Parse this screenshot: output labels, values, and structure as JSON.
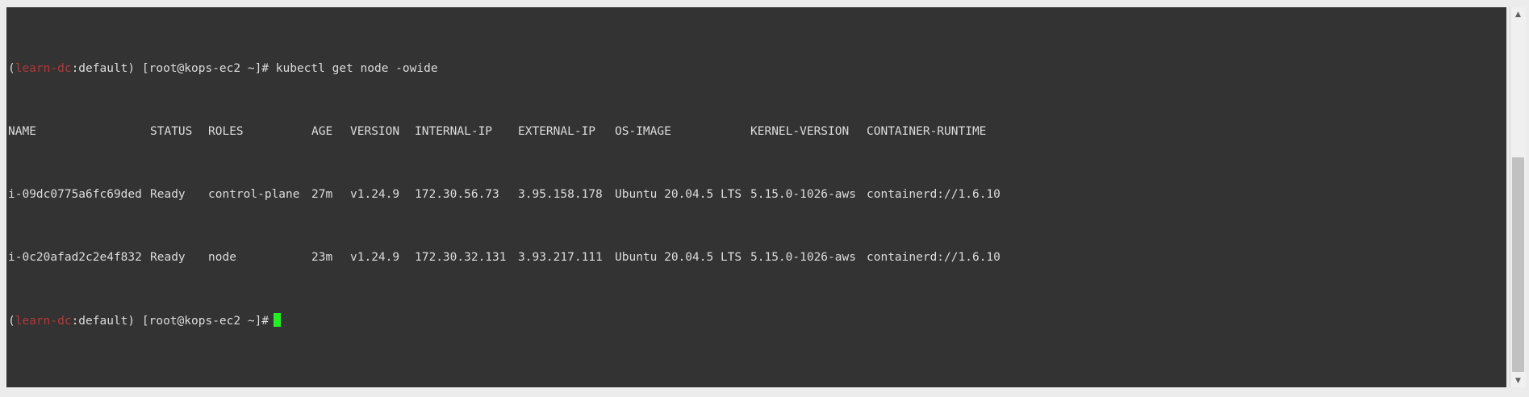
{
  "terminal": {
    "prompt": {
      "open_paren": "(",
      "context": "learn-dc",
      "namespace": ":default",
      "close": ") ",
      "user_host": "[root@kops-ec2 ~]#"
    },
    "command": " kubectl get node -owide",
    "table": {
      "headers": [
        "NAME",
        "STATUS",
        "ROLES",
        "AGE",
        "VERSION",
        "INTERNAL-IP",
        "EXTERNAL-IP",
        "OS-IMAGE",
        "KERNEL-VERSION",
        "CONTAINER-RUNTIME"
      ],
      "rows": [
        [
          "i-09dc0775a6fc69ded",
          "Ready",
          "control-plane",
          "27m",
          "v1.24.9",
          "172.30.56.73",
          "3.95.158.178",
          "Ubuntu 20.04.5 LTS",
          "5.15.0-1026-aws",
          "containerd://1.6.10"
        ],
        [
          "i-0c20afad2c2e4f832",
          "Ready",
          "node",
          "23m",
          "v1.24.9",
          "172.30.32.131",
          "3.93.217.111",
          "Ubuntu 20.04.5 LTS",
          "5.15.0-1026-aws",
          "containerd://1.6.10"
        ]
      ]
    },
    "colors": {
      "background": "#333333",
      "text": "#dcdcdc",
      "context": "#b03a3a",
      "cursor": "#22ee22"
    }
  },
  "scrollbar": {
    "up_icon": "triangle-up-icon",
    "down_icon": "triangle-down-icon"
  }
}
